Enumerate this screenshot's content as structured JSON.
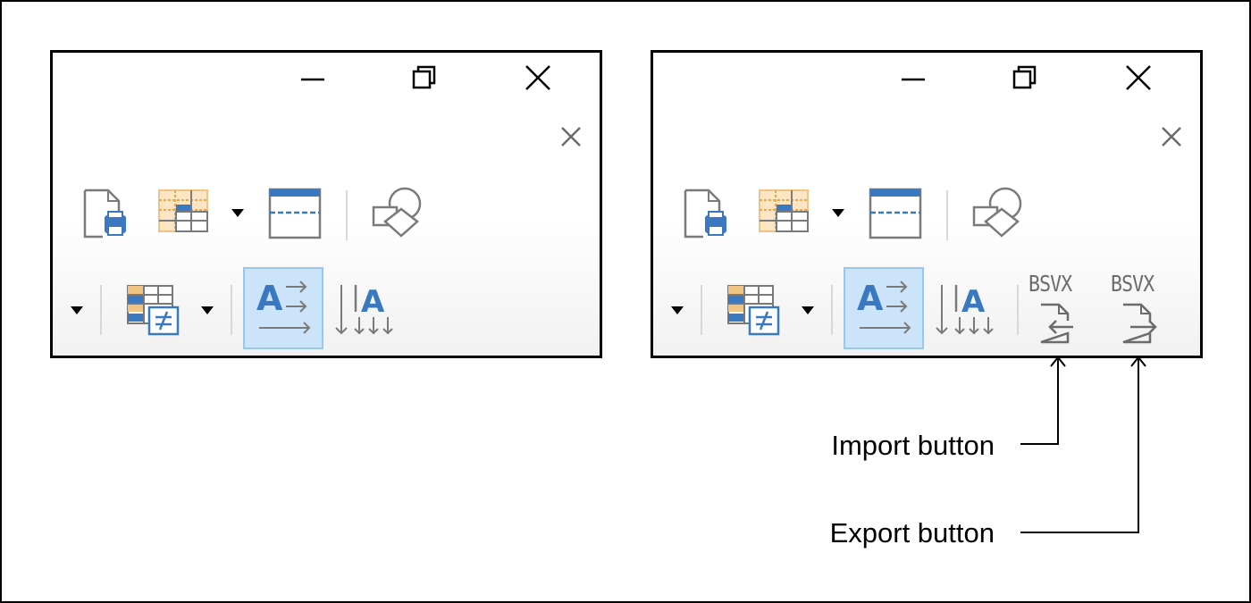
{
  "callouts": {
    "import": "Import button",
    "export": "Export button"
  },
  "ribbon": {
    "import_format": "BSVX",
    "export_format": "BSVX"
  },
  "icons": {
    "minimize": "minimize-icon",
    "restore": "restore-icon",
    "close": "close-icon",
    "panel_close": "panel-close-icon",
    "print": "print-preview-icon",
    "table_grid": "table-grid-icon",
    "page_break": "page-break-icon",
    "shapes": "shapes-icon",
    "conditional_format": "conditional-format-icon",
    "sort_ascending": "sort-ascending-icon",
    "sort_descending": "sort-descending-icon",
    "import": "import-file-icon",
    "export": "export-file-icon"
  },
  "colors": {
    "accent_blue": "#3a78c0",
    "grid_orange": "#f1c483",
    "highlight": "#cbe4f9",
    "highlight_border": "#98c7ee",
    "icon_gray": "#6b6b6b"
  }
}
